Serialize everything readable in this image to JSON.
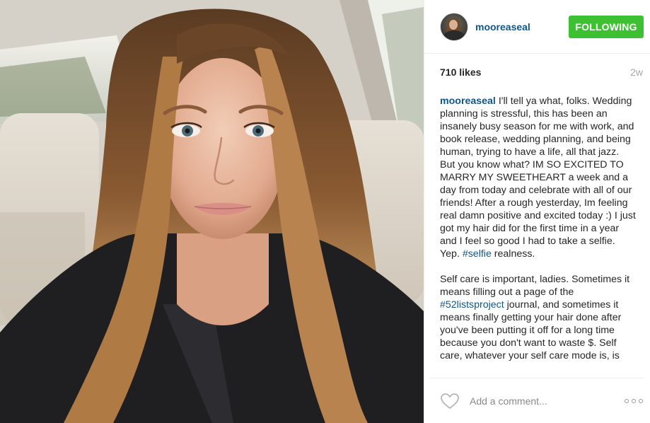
{
  "post": {
    "username": "mooreaseal",
    "follow_label": "FOLLOWING",
    "likes": "710 likes",
    "age": "2w",
    "caption": {
      "username": "mooreaseal",
      "p1": " I'll tell ya what, folks. Wedding planning is stressful, this has been an insanely busy season for me with work, and book release, wedding planning, and being human, trying to have a life, all that jazz.",
      "p2_before": "But you know what? IM SO EXCITED TO MARRY MY SWEETHEART a week and a day from today and celebrate with all of our friends! After a rough yesterday, Im feeling real damn positive and excited today :) I just got my hair did for the first time in a year and I feel so good I had to take a selfie. Yep. ",
      "tag1": "#selfie",
      "p2_after": " realness.",
      "p3_before": "Self care is important, ladies. Sometimes it means filling out a page of the ",
      "tag2": "#52listsproject",
      "p3_after": " journal, and sometimes it means finally getting your hair done after you've been putting it off for a long time because you don't want to waste $. Self care, whatever your self care mode is, is"
    },
    "comment_placeholder": "Add a comment..."
  },
  "icons": {
    "like": "heart-outline-icon",
    "more": "more-options-icon"
  },
  "colors": {
    "link": "#125688",
    "following_button": "#3ec033",
    "muted": "#a5a7aa",
    "text": "#262626"
  }
}
